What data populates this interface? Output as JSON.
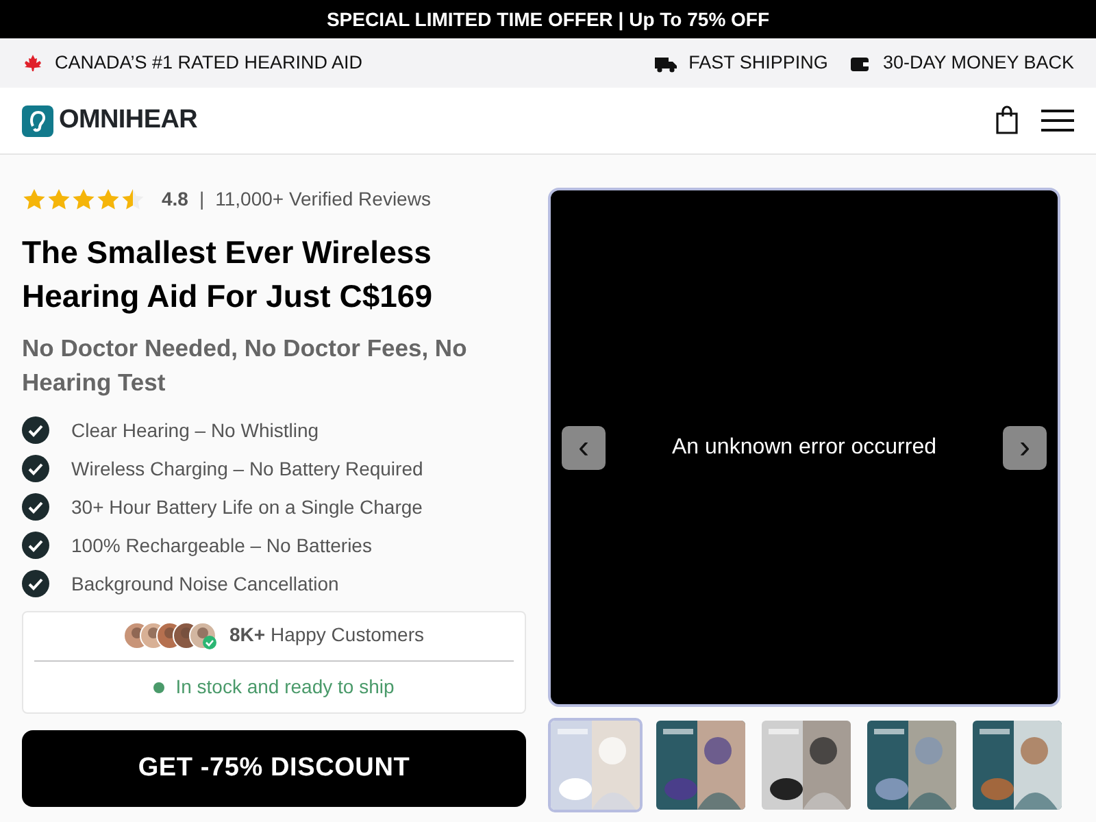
{
  "promo_bar": {
    "text": "SPECIAL LIMITED TIME OFFER | Up To 75% OFF"
  },
  "info_bar": {
    "left": "CANADA’S #1 RATED HEARIND AID",
    "items": [
      {
        "kind": "truck",
        "text": "FAST SHIPPING"
      },
      {
        "kind": "wallet",
        "text": "30-DAY MONEY BACK"
      }
    ]
  },
  "header": {
    "logo": "OMNIHEAR"
  },
  "rating": {
    "stars": 4.5,
    "score": "4.8",
    "separator": "|",
    "reviews": "11,000+ Verified Reviews"
  },
  "title": "The Smallest Ever Wireless Hearing Aid For Just C$169",
  "subtitle": "No Doctor Needed, No Doctor Fees, No Hearing Test",
  "features": [
    "Clear Hearing – No Whistling",
    "Wireless Charging – No Battery Required",
    "30+ Hour Battery Life on a Single Charge",
    "100% Rechargeable – No Batteries",
    "Background Noise Cancellation"
  ],
  "social_proof": {
    "customers": "**8K+** Happy Customers",
    "stock": "In stock and ready to ship"
  },
  "cta": "GET -75% DISCOUNT",
  "gallery": {
    "error": "An unknown error occurred",
    "prev": "‹",
    "next": "›",
    "thumbnails": [
      {
        "kind": "picture",
        "selected": true
      },
      {
        "kind": "picture",
        "selected": false
      },
      {
        "kind": "picture",
        "selected": false
      },
      {
        "kind": "picture",
        "selected": false
      },
      {
        "kind": "picture",
        "selected": false
      }
    ]
  }
}
